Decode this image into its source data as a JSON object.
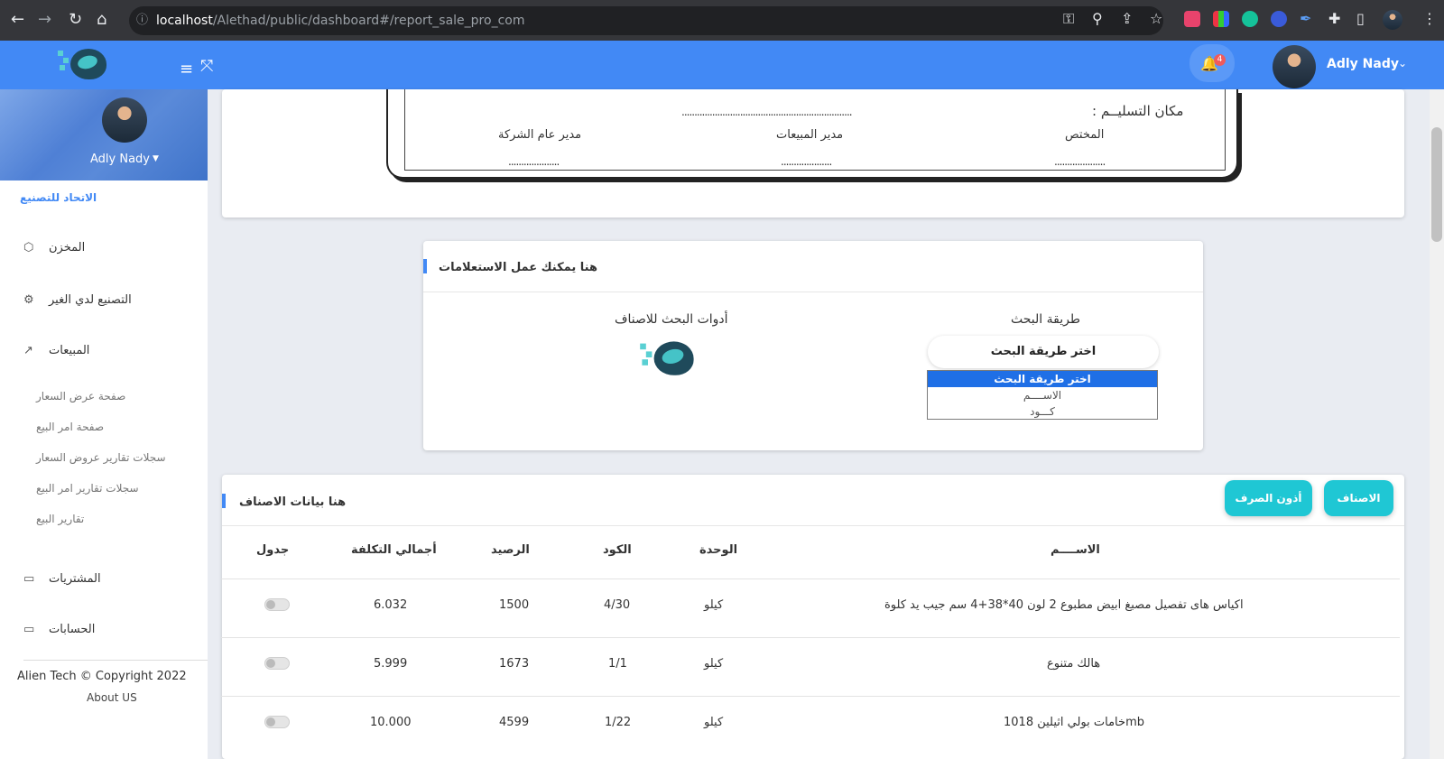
{
  "browser": {
    "url_host": "localhost",
    "url_path": "/Alethad/public/dashboard#/report_sale_pro_com"
  },
  "header": {
    "notifications_count": "4",
    "user_name": "Adly Nady"
  },
  "sidebar": {
    "user_name": "Adly Nady",
    "brand": "الاتحاد للتصنيع",
    "items": [
      {
        "label": "المخزن",
        "icon": "box-icon"
      },
      {
        "label": "التصنيع لدي الغير",
        "icon": "gear-icon"
      },
      {
        "label": "المبيعات",
        "icon": "trend-chart-icon"
      }
    ],
    "sub_items": [
      "صفحة عرض السعار",
      "صفحة امر البيع",
      "سجلات تقارير عروض السعار",
      "سجلات تقارير امر البيع",
      "تقارير البيع"
    ],
    "items_bottom": [
      {
        "label": "المشتريات",
        "icon": "card-icon"
      },
      {
        "label": "الحسابات",
        "icon": "card-icon"
      }
    ],
    "copyright": "Alien Tech © Copyright 2022",
    "about": "About US"
  },
  "print_form": {
    "delivery_label": "مكان التسليــم :",
    "delivery_dots": "...................................................................",
    "signatures": [
      {
        "title": "المختص",
        "dots": "...................."
      },
      {
        "title": "مدير المبيعات",
        "dots": "...................."
      },
      {
        "title": "مدير عام الشركة",
        "dots": "...................."
      }
    ]
  },
  "query_card": {
    "title": "هنا يمكنك عمل الاستعلامات",
    "search_method_label": "طريقة البحث",
    "search_tools_label": "أدوات البحث للاصناف",
    "select_value": "اختر طريقة البحث",
    "options": [
      "اختر طريقة البحث",
      "الاســــم",
      "كـــود"
    ]
  },
  "items_card": {
    "title": "هنا بيانات الاصناف",
    "btn_items": "الاصناف",
    "btn_vouchers": "أذون الصرف",
    "columns": [
      "الاســــم",
      "الوحدة",
      "الكود",
      "الرصيد",
      "أجمالي التكلفة",
      "جدول"
    ],
    "rows": [
      {
        "name": "اكياس هاى تفصيل مصبغ ابيض مطبوع 2 لون 40*38+4 سم جيب يد كلوة",
        "unit": "كيلو",
        "code": "4/30",
        "balance": "1500",
        "cost": "6.032"
      },
      {
        "name": "هالك متنوع",
        "unit": "كيلو",
        "code": "1/1",
        "balance": "1673",
        "cost": "5.999"
      },
      {
        "name": "mbخامات بولي اثيلين 1018",
        "unit": "كيلو",
        "code": "1/22",
        "balance": "4599",
        "cost": "10.000"
      }
    ]
  },
  "colors": {
    "primary": "#4289f5",
    "accent": "#1fc7d4"
  }
}
